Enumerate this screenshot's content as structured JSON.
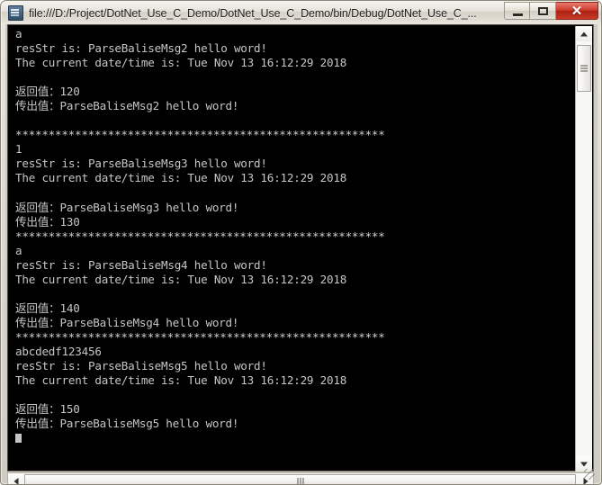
{
  "window": {
    "title": "file:///D:/Project/DotNet_Use_C_Demo/DotNet_Use_C_Demo/bin/Debug/DotNet_Use_C_...",
    "icon": "console-app-icon",
    "caption_buttons": {
      "minimize_label": "Minimize",
      "maximize_label": "Maximize",
      "close_label": "✕"
    },
    "colors": {
      "titlebar_text": "#21201d",
      "close_button": "#cf3b2b",
      "console_background": "#000000",
      "console_text": "#c6c6c6",
      "frame": "#cfccc3"
    }
  },
  "console": {
    "lines": [
      "a",
      "resStr is: ParseBaliseMsg2 hello word!",
      "The current date/time is: Tue Nov 13 16:12:29 2018",
      "",
      "返回值：120",
      "传出值：ParseBaliseMsg2 hello word!",
      "",
      "********************************************************",
      "1",
      "resStr is: ParseBaliseMsg3 hello word!",
      "The current date/time is: Tue Nov 13 16:12:29 2018",
      "",
      "返回值：ParseBaliseMsg3 hello word!",
      "传出值：130",
      "********************************************************",
      "a",
      "resStr is: ParseBaliseMsg4 hello word!",
      "The current date/time is: Tue Nov 13 16:12:29 2018",
      "",
      "返回值：140",
      "传出值：ParseBaliseMsg4 hello word!",
      "********************************************************",
      "abcdedf123456",
      "resStr is: ParseBaliseMsg5 hello word!",
      "The current date/time is: Tue Nov 13 16:12:29 2018",
      "",
      "返回值：150",
      "传出值：ParseBaliseMsg5 hello word!"
    ],
    "separator_line": "********************************************************",
    "cursor_visible": true
  },
  "scrollbars": {
    "vertical": {
      "up_arrow": "scroll-up-arrow",
      "down_arrow": "scroll-down-arrow",
      "thumb_top_pct": 4,
      "thumb_height_pct": 11
    },
    "horizontal": {
      "left_arrow": "scroll-left-arrow",
      "right_arrow": "scroll-right-arrow",
      "thumb_left_pct": 3,
      "thumb_width_pct": 94
    }
  }
}
